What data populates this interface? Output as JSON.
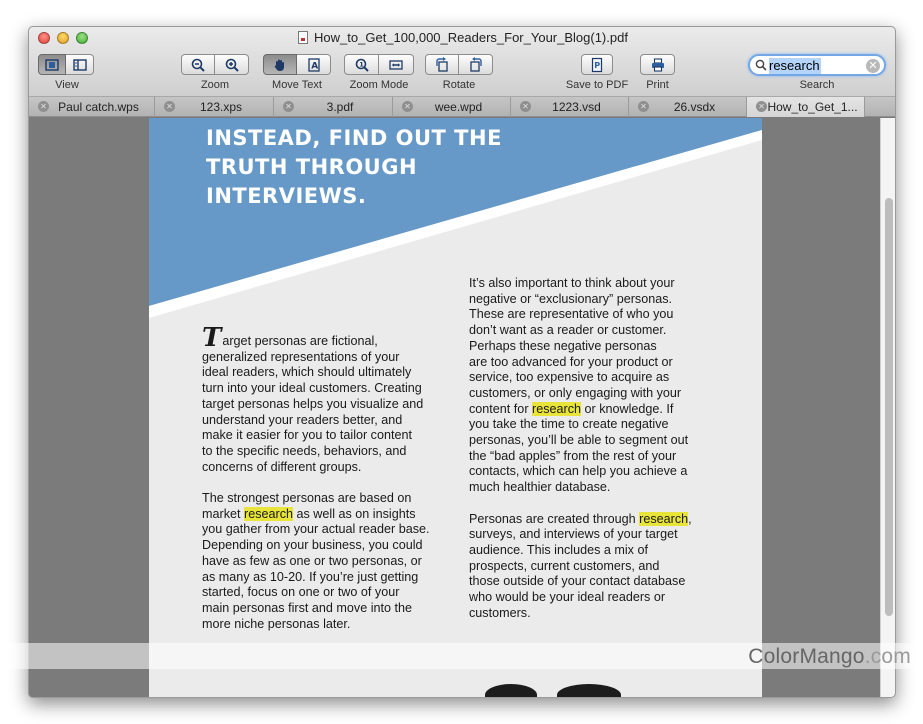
{
  "window": {
    "title": "How_to_Get_100,000_Readers_For_Your_Blog(1).pdf"
  },
  "toolbar": {
    "view_label": "View",
    "zoom_label": "Zoom",
    "move_text_label": "Move Text",
    "zoom_mode_label": "Zoom Mode",
    "rotate_label": "Rotate",
    "save_pdf_label": "Save to PDF",
    "print_label": "Print",
    "search_label": "Search"
  },
  "search": {
    "value": "research"
  },
  "tabs": [
    {
      "label": "Paul catch.wps"
    },
    {
      "label": "123.xps"
    },
    {
      "label": "3.pdf"
    },
    {
      "label": "wee.wpd"
    },
    {
      "label": "1223.vsd"
    },
    {
      "label": "26.vsdx"
    },
    {
      "label": "How_to_Get_1..."
    }
  ],
  "document": {
    "headline": [
      "INSTEAD, FIND OUT THE",
      "TRUTH THROUGH",
      "INTERVIEWS."
    ],
    "left_col": {
      "dropcap": "T",
      "p1": [
        "arget personas are fictional,",
        "generalized representations of your",
        "ideal readers, which should ultimately",
        "turn into your ideal customers. Creating",
        "target personas helps you visualize and",
        "understand your readers better, and",
        "make it easier for you to tailor content",
        "to the specific needs, behaviors, and",
        "concerns of different groups."
      ],
      "p2_l0": "The strongest personas are based on",
      "p2_l1_pre": "market ",
      "p2_l1_hl": "research",
      "p2_l1_post": " as well as on insights",
      "p2_rest": [
        "you gather from your actual reader base.",
        "Depending on your business, you could",
        "have as few as one or two personas, or",
        "as many as 10-20. If you’re just getting",
        "started, focus on one or two of your",
        "main personas first and move into the",
        "more niche personas later."
      ]
    },
    "right_col": {
      "p1_a": [
        "It’s also important to think about your",
        "negative or “exclusionary” personas.",
        "These are representative of who you",
        "don’t want as a reader or customer.",
        "Perhaps these negative personas",
        "are too advanced for your product or",
        "service, too expensive to acquire as",
        "customers, or only engaging with your"
      ],
      "p1_hl_pre": "content for ",
      "p1_hl": "research",
      "p1_hl_post": " or knowledge. If",
      "p1_b": [
        "you take the time to create negative",
        "personas, you’ll be able to segment out",
        "the “bad apples” from the rest of your",
        "contacts, which can help you achieve a",
        "much healthier database."
      ],
      "p2_l0_pre": "Personas are created through ",
      "p2_l0_hl": "research",
      "p2_l0_post": ",",
      "p2_rest": [
        "surveys, and interviews of your target",
        "audience. This includes a mix of",
        "prospects, current customers, and",
        "those outside of your contact database",
        "who would be your ideal readers or",
        "customers."
      ]
    }
  },
  "watermark": {
    "part1": "ColorMango",
    "part2": ".com"
  },
  "colors": {
    "banner_blue": "#6699c7",
    "highlight": "#e8e43a",
    "search_focus": "#73a7e6"
  }
}
